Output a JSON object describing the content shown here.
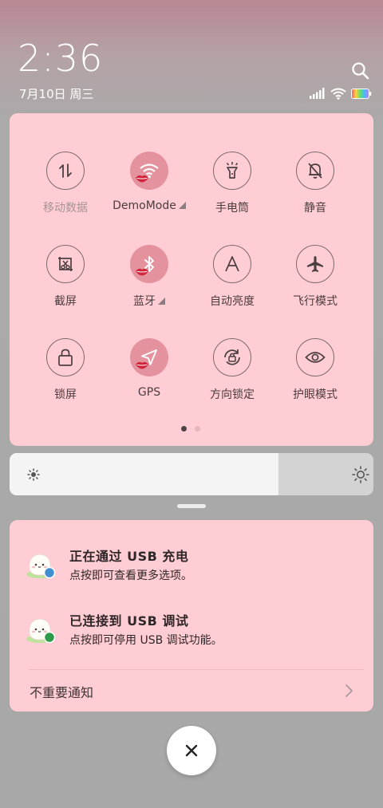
{
  "status": {
    "time": "2:36",
    "date": "7月10日 周三",
    "icons": [
      "signal-icon",
      "wifi-icon",
      "battery-icon"
    ]
  },
  "header": {
    "search_icon": "search-icon"
  },
  "quick_settings": {
    "tiles": [
      {
        "label": "移动数据",
        "icon": "mobile-data-icon",
        "active": false,
        "dimmed": true
      },
      {
        "label": "DemoMode",
        "icon": "wifi-icon",
        "active": true,
        "expandable": true
      },
      {
        "label": "手电筒",
        "icon": "flashlight-icon",
        "active": false
      },
      {
        "label": "静音",
        "icon": "mute-bell-icon",
        "active": false
      },
      {
        "label": "截屏",
        "icon": "screenshot-icon",
        "active": false
      },
      {
        "label": "蓝牙",
        "icon": "bluetooth-icon",
        "active": true,
        "expandable": true
      },
      {
        "label": "自动亮度",
        "icon": "auto-brightness-icon",
        "active": false
      },
      {
        "label": "飞行模式",
        "icon": "airplane-icon",
        "active": false
      },
      {
        "label": "锁屏",
        "icon": "lock-icon",
        "active": false
      },
      {
        "label": "GPS",
        "icon": "gps-icon",
        "active": true
      },
      {
        "label": "方向锁定",
        "icon": "rotation-lock-icon",
        "active": false
      },
      {
        "label": "护眼模式",
        "icon": "eye-icon",
        "active": false
      }
    ],
    "page_count": 2,
    "current_page": 1
  },
  "brightness": {
    "level_percent": 74
  },
  "notifications": {
    "items": [
      {
        "title": "正在通过 USB 充电",
        "subtitle": "点按即可查看更多选项。",
        "badge_color": "#3f8fd1"
      },
      {
        "title": "已连接到 USB 调试",
        "subtitle": "点按即可停用 USB 调试功能。",
        "badge_color": "#2f9a4a"
      }
    ],
    "unimportant_label": "不重要通知"
  },
  "colors": {
    "panel": "#ffcdd3",
    "tile_active": "#e5929f",
    "lips": "#d0233c"
  }
}
